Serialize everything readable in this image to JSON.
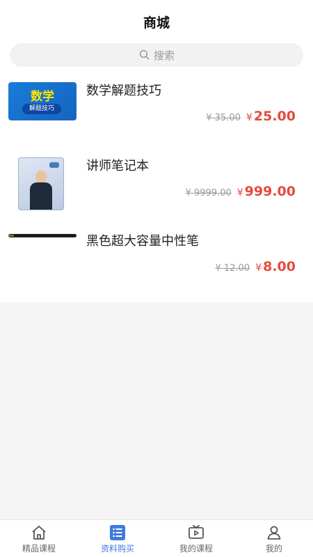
{
  "header": {
    "title": "商城"
  },
  "search": {
    "placeholder": "搜索"
  },
  "products": [
    {
      "name": "数学解题技巧",
      "old_price": "35.00",
      "new_price": "25.00",
      "currency": "¥",
      "thumb_text": "数学",
      "thumb_sub": "解题技巧"
    },
    {
      "name": "讲师笔记本",
      "old_price": "9999.00",
      "new_price": "999.00",
      "currency": "¥"
    },
    {
      "name": "黑色超大容量中性笔",
      "old_price": "12.00",
      "new_price": "8.00",
      "currency": "¥"
    }
  ],
  "tabbar": {
    "items": [
      {
        "label": "精品课程",
        "icon": "home-icon"
      },
      {
        "label": "资料购买",
        "icon": "list-icon",
        "active": true
      },
      {
        "label": "我的课程",
        "icon": "video-icon"
      },
      {
        "label": "我的",
        "icon": "user-icon"
      }
    ]
  },
  "colors": {
    "accent": "#3f7ae0",
    "price": "#e64a3b"
  }
}
